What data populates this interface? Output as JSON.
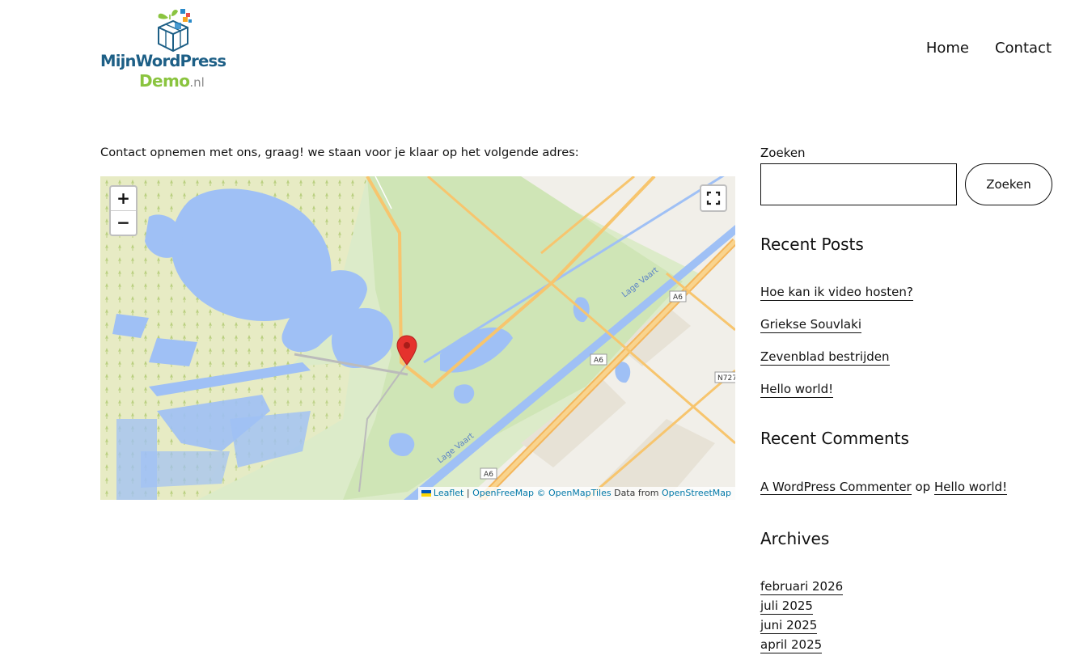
{
  "logo": {
    "line1": "MijnWordPress",
    "line2_main": "Demo",
    "line2_suffix": ".nl",
    "icon": "boxes-with-plants-logo-icon"
  },
  "nav": {
    "items": [
      "Home",
      "Contact"
    ]
  },
  "main": {
    "intro": "Contact opnemen met ons, graag! we staan voor je klaar op het volgende adres:"
  },
  "map": {
    "zoom_in": "+",
    "zoom_out": "−",
    "fullscreen_icon": "fullscreen-icon",
    "marker_icon": "map-pin-icon",
    "road_labels": [
      "A6",
      "A6",
      "A6",
      "N727",
      "Lage Vaart",
      "Lage Vaart"
    ],
    "attribution": {
      "leaflet": "Leaflet",
      "separator": "|",
      "openfreemap": "OpenFreeMap",
      "openmaptiles": "© OpenMapTiles",
      "data_from": "Data from",
      "openstreetmap": "OpenStreetMap"
    },
    "colors": {
      "water": "#9fc0f5",
      "land": "#dcebc9",
      "urban": "#f1efe9",
      "road": "#f7c56e",
      "marker": "#e5322d"
    }
  },
  "sidebar": {
    "search_label": "Zoeken",
    "search_value": "",
    "search_button": "Zoeken",
    "recent_posts_title": "Recent Posts",
    "recent_posts": [
      "Hoe kan ik video hosten?",
      "Griekse Souvlaki",
      "Zevenblad bestrijden",
      "Hello world!"
    ],
    "recent_comments_title": "Recent Comments",
    "comment": {
      "author": "A WordPress Commenter",
      "joiner": "op",
      "post": "Hello world!"
    },
    "archives_title": "Archives",
    "archives": [
      "februari 2026",
      "juli 2025",
      "juni 2025",
      "april 2025"
    ]
  }
}
